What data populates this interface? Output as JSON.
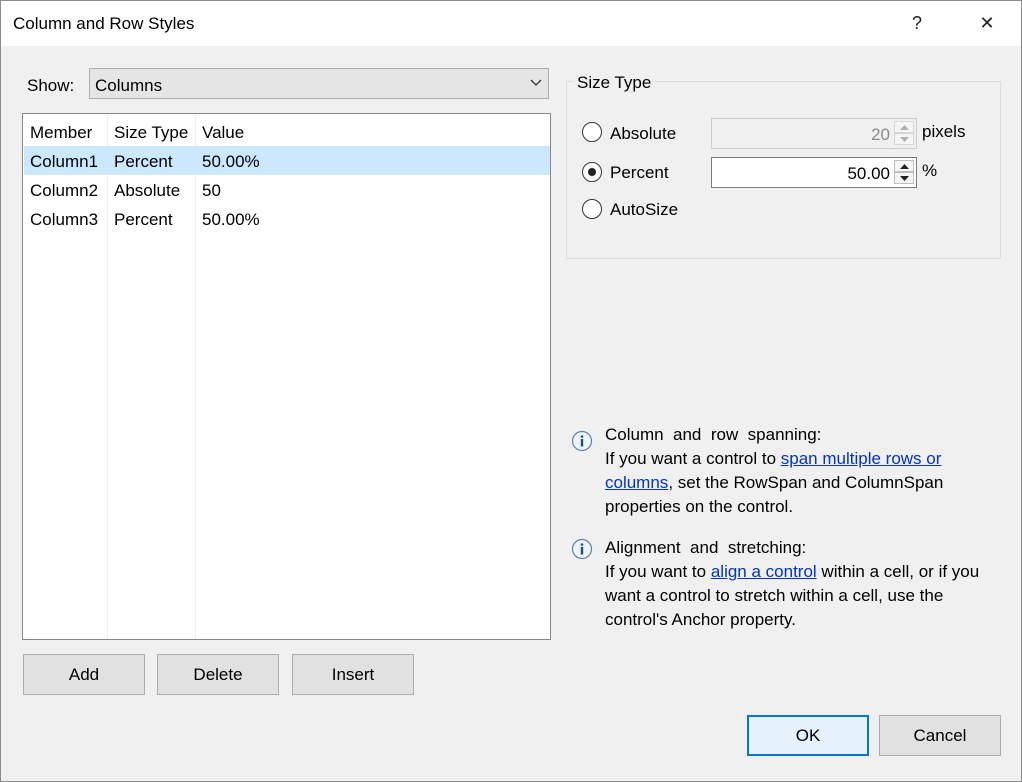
{
  "window": {
    "title": "Column and Row Styles",
    "help_label": "?",
    "close_label": "✕"
  },
  "show": {
    "label": "Show:",
    "value": "Columns"
  },
  "grid": {
    "headers": [
      "Member",
      "Size Type",
      "Value"
    ],
    "rows": [
      {
        "member": "Column1",
        "size_type": "Percent",
        "value": "50.00%",
        "selected": true
      },
      {
        "member": "Column2",
        "size_type": "Absolute",
        "value": "50",
        "selected": false
      },
      {
        "member": "Column3",
        "size_type": "Percent",
        "value": "50.00%",
        "selected": false
      }
    ]
  },
  "buttons": {
    "add": "Add",
    "delete": "Delete",
    "insert": "Insert",
    "ok": "OK",
    "cancel": "Cancel"
  },
  "size_type": {
    "title": "Size Type",
    "absolute_label": "Absolute",
    "absolute_value": "20",
    "absolute_unit": "pixels",
    "percent_label": "Percent",
    "percent_value": "50.00",
    "percent_unit": "%",
    "autosize_label": "AutoSize",
    "selected": "percent"
  },
  "info": {
    "spanning": {
      "heading": "Column  and  row  spanning:",
      "text_before": "If you want a control to ",
      "link": "span multiple rows or columns",
      "text_after": ", set the RowSpan and ColumnSpan properties on the control."
    },
    "alignment": {
      "heading": "Alignment  and  stretching:",
      "text_before": "If you want to ",
      "link": "align a control",
      "text_after": " within a cell, or if you want a control to stretch within a cell, use the control's Anchor property."
    }
  },
  "colors": {
    "selection": "#cce8ff",
    "accent": "#0078d7",
    "link": "#0033cc"
  }
}
